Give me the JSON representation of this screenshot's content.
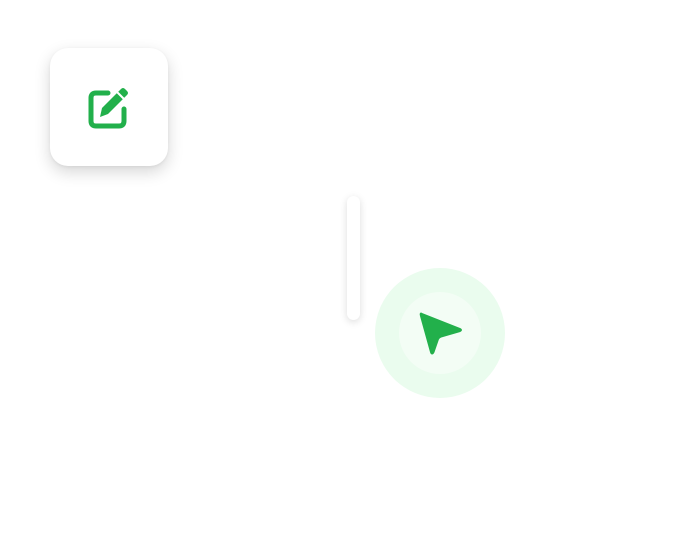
{
  "colors": {
    "accent": "#22b04b",
    "halo_outer": "#eafcee",
    "halo_inner": "#f3fdf5"
  },
  "icons": {
    "edit": "edit-pencil-icon",
    "navigation": "navigation-arrow-icon"
  }
}
